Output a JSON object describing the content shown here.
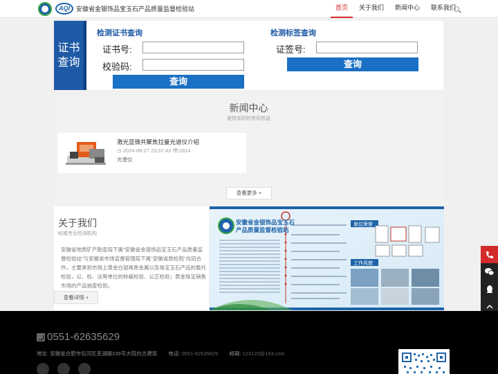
{
  "header": {
    "logo_text": "AQI",
    "site_title": "安徽省金银饰品宝玉石产品质量监督检验站",
    "nav": [
      {
        "label": "首页",
        "active": true
      },
      {
        "label": "关于我们",
        "active": false
      },
      {
        "label": "新闻中心",
        "active": false
      },
      {
        "label": "联系我们",
        "active": false
      }
    ]
  },
  "query": {
    "tab_line1": "证书",
    "tab_line2": "查询",
    "cert": {
      "title": "检测证书查询",
      "cert_no_label": "证书号:",
      "check_code_label": "校验码:",
      "button": "查询"
    },
    "tag": {
      "title": "检测标签查询",
      "tag_no_label": "证签号:",
      "button": "查询"
    }
  },
  "news": {
    "title": "新闻中心",
    "subtitle": "提供实时的资讯信息",
    "items": [
      {
        "title": "激光显微共聚焦拉曼光谱仪介绍",
        "date": "2024-08-27 23:37:43",
        "views": "2814",
        "tag": "光谱仪"
      }
    ],
    "more_label": "查看更多 +"
  },
  "about": {
    "title": "关于我们",
    "subtitle": "权威专业检测机构",
    "text": "安徽省地质矿产勘查局下属\"安徽省金银饰品宝玉石产品质量监督检验站\"与安徽省市场监督管理局下属\"安徽省质检院\"共同合作，主要承担市场上黄金白银再贵金属以及珠宝玉石产品的委托检验，公、检、法等单位的仲裁检验、公正检验；黄金珠宝销售市场的产品抽查检验。",
    "button": "查看详情 +"
  },
  "poster": {
    "org_name_line1": "安徽省金银饰品宝玉石",
    "org_name_line2": "产品质量监督检验站",
    "honor_label": "单位荣誉",
    "style_label": "工作风貌"
  },
  "footer": {
    "phone": "0551-62635629",
    "address_label": "地址:",
    "address": "安徽省合肥市包河区芜湖路239号大院内古建筑",
    "tel_label": "电话:",
    "tel": "0551-62635629",
    "email_label": "邮箱:",
    "email": "123123@163.com"
  },
  "colors": {
    "brand_blue": "#1f5aa6",
    "button_blue": "#1a70c4",
    "accent_red": "#d32b2b",
    "footer_bg": "#000000"
  }
}
